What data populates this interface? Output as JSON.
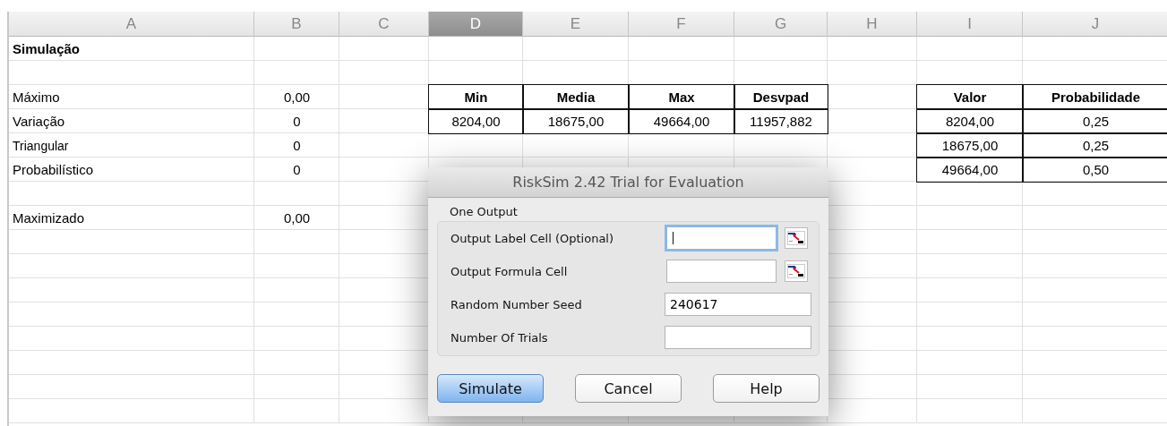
{
  "sheet": {
    "columns": [
      {
        "label": "A",
        "selected": false
      },
      {
        "label": "B",
        "selected": false
      },
      {
        "label": "C",
        "selected": false
      },
      {
        "label": "D",
        "selected": true
      },
      {
        "label": "E",
        "selected": false
      },
      {
        "label": "F",
        "selected": false
      },
      {
        "label": "G",
        "selected": false
      },
      {
        "label": "H",
        "selected": false
      },
      {
        "label": "I",
        "selected": false
      },
      {
        "label": "J",
        "selected": false
      }
    ],
    "rows": [
      {
        "col_a": {
          "kind": "title",
          "text": "Simulação"
        }
      },
      {},
      {
        "col_a": {
          "kind": "label",
          "text": "Máximo"
        },
        "col_b": {
          "kind": "value",
          "text": "0,00"
        },
        "col_d": {
          "kind": "header",
          "text": "Min"
        },
        "col_e": {
          "kind": "header",
          "text": "Media"
        },
        "col_f": {
          "kind": "header",
          "text": "Max"
        },
        "col_g": {
          "kind": "header",
          "text": "Desvpad"
        },
        "col_i": {
          "kind": "header",
          "text": "Valor"
        },
        "col_j": {
          "kind": "header",
          "text": "Probabilidade"
        }
      },
      {
        "col_a": {
          "kind": "label",
          "text": "Variação"
        },
        "col_b": {
          "kind": "value",
          "text": "0"
        },
        "col_d": {
          "kind": "boxed",
          "text": "8204,00"
        },
        "col_e": {
          "kind": "boxed",
          "text": "18675,00"
        },
        "col_f": {
          "kind": "boxed",
          "text": "49664,00"
        },
        "col_g": {
          "kind": "boxed",
          "text": "11957,882"
        },
        "col_i": {
          "kind": "boxed",
          "text": "8204,00"
        },
        "col_j": {
          "kind": "boxed",
          "text": "0,25"
        }
      },
      {
        "col_a": {
          "kind": "small_label",
          "text": "Triangular"
        },
        "col_b": {
          "kind": "value",
          "text": "0"
        },
        "col_i": {
          "kind": "boxed",
          "text": "18675,00"
        },
        "col_j": {
          "kind": "boxed",
          "text": "0,25"
        }
      },
      {
        "col_a": {
          "kind": "label",
          "text": "Probabilístico"
        },
        "col_b": {
          "kind": "value",
          "text": "0"
        },
        "col_i": {
          "kind": "boxed",
          "text": "49664,00"
        },
        "col_j": {
          "kind": "boxed",
          "text": "0,50"
        }
      },
      {},
      {
        "col_a": {
          "kind": "label",
          "text": "Maximizado"
        },
        "col_b": {
          "kind": "value",
          "text": "0,00"
        }
      },
      {},
      {},
      {},
      {},
      {},
      {},
      {},
      {}
    ]
  },
  "dialog": {
    "title": "RiskSim 2.42 Trial for Evaluation",
    "section": "One Output",
    "fields": [
      {
        "label": "Output Label Cell (Optional)",
        "focused": true,
        "picker": true
      },
      {
        "label": "Output Formula Cell",
        "focused": false,
        "picker": true
      },
      {
        "label": "Random Number Seed",
        "value": "240617",
        "focused": false
      },
      {
        "label": "Number Of Trials",
        "focused": false
      }
    ],
    "buttons": [
      {
        "label": "Simulate",
        "default": true
      },
      {
        "label": "Cancel",
        "default": false
      },
      {
        "label": "Help",
        "default": false
      }
    ]
  }
}
